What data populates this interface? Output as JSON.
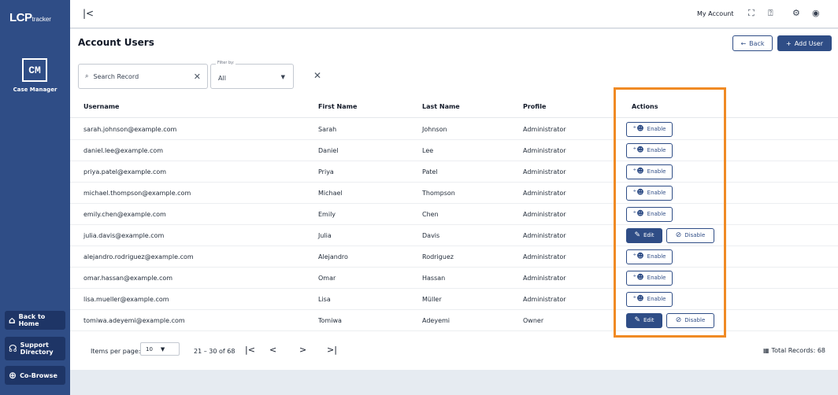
{
  "sidebar": {
    "logo_main": "LCP",
    "logo_sub": "tracker",
    "cm_badge": "CM",
    "cm_label": "Case Manager",
    "back_home": "Back to Home",
    "support_line1": "Support",
    "support_line2": "Directory",
    "cobrowse": "Co-Browse"
  },
  "topbar": {
    "collapse_icon": "collapse-left-icon",
    "my_account": "My Account",
    "icons": [
      "fullscreen-icon",
      "help-icon",
      "settings-icon",
      "account-icon"
    ]
  },
  "page": {
    "title": "Account Users",
    "back_label": "Back",
    "add_user_label": "Add User"
  },
  "search": {
    "placeholder": "Search Record"
  },
  "filter": {
    "label": "Filter by:",
    "value": "All"
  },
  "table": {
    "headers": [
      "Username",
      "First Name",
      "Last Name",
      "Profile",
      "Actions"
    ],
    "enable_label": "Enable",
    "edit_label": "Edit",
    "disable_label": "Disable",
    "rows": [
      {
        "username": "sarah.johnson@example.com",
        "first": "Sarah",
        "last": "Johnson",
        "profile": "Administrator",
        "actions": "enable"
      },
      {
        "username": "daniel.lee@example.com",
        "first": "Daniel",
        "last": "Lee",
        "profile": "Administrator",
        "actions": "enable"
      },
      {
        "username": "priya.patel@example.com",
        "first": "Priya",
        "last": "Patel",
        "profile": "Administrator",
        "actions": "enable"
      },
      {
        "username": "michael.thompson@example.com",
        "first": "Michael",
        "last": "Thompson",
        "profile": "Administrator",
        "actions": "enable"
      },
      {
        "username": "emily.chen@example.com",
        "first": "Emily",
        "last": "Chen",
        "profile": "Administrator",
        "actions": "enable"
      },
      {
        "username": "julia.davis@example.com",
        "first": "Julia",
        "last": "Davis",
        "profile": "Administrator",
        "actions": "edit-disable"
      },
      {
        "username": "alejandro.rodriguez@example.com",
        "first": "Alejandro",
        "last": "Rodriguez",
        "profile": "Administrator",
        "actions": "enable"
      },
      {
        "username": "omar.hassan@example.com",
        "first": "Omar",
        "last": "Hassan",
        "profile": "Administrator",
        "actions": "enable"
      },
      {
        "username": "lisa.mueller@example.com",
        "first": "Lisa",
        "last": "Müller",
        "profile": "Administrator",
        "actions": "enable"
      },
      {
        "username": "tomiwa.adeyemi@example.com",
        "first": "Tomiwa",
        "last": "Adeyemi",
        "profile": "Owner",
        "actions": "edit-disable"
      }
    ]
  },
  "pagination": {
    "items_per_page_label": "Items per page:",
    "items_per_page_value": "10",
    "range": "21 – 30 of 68",
    "total_label": "Total Records: 68"
  },
  "colors": {
    "brand": "#2f4d86",
    "highlight": "#f08a24"
  }
}
